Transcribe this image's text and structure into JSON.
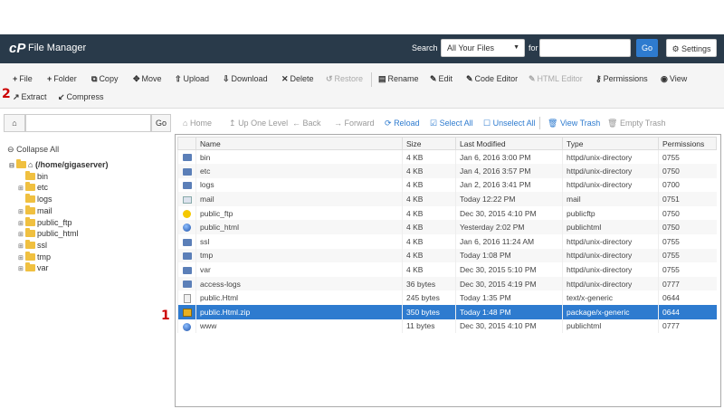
{
  "header": {
    "logo": "cP",
    "title": "File Manager",
    "search_label": "Search",
    "search_scope": "All Your Files",
    "for_label": "for",
    "search_value": "",
    "go_label": "Go",
    "settings_label": "Settings"
  },
  "toolbar": {
    "file": "File",
    "folder": "Folder",
    "copy": "Copy",
    "move": "Move",
    "upload": "Upload",
    "download": "Download",
    "delete": "Delete",
    "restore": "Restore",
    "rename": "Rename",
    "edit": "Edit",
    "code_editor": "Code Editor",
    "html_editor": "HTML Editor",
    "permissions": "Permissions",
    "view": "View",
    "extract": "Extract",
    "compress": "Compress"
  },
  "annotations": {
    "step1": "1",
    "step2": "2"
  },
  "left_pane": {
    "path_value": "",
    "go_label": "Go",
    "collapse_all": "Collapse All",
    "root": "(/home/gigaserver)",
    "tree": [
      "bin",
      "etc",
      "logs",
      "mail",
      "public_ftp",
      "public_html",
      "ssl",
      "tmp",
      "var"
    ]
  },
  "nav": {
    "home": "Home",
    "up": "Up One Level",
    "back": "Back",
    "forward": "Forward",
    "reload": "Reload",
    "select_all": "Select All",
    "unselect_all": "Unselect All",
    "view_trash": "View Trash",
    "empty_trash": "Empty Trash"
  },
  "table": {
    "headers": {
      "name": "Name",
      "size": "Size",
      "modified": "Last Modified",
      "type": "Type",
      "perms": "Permissions"
    },
    "rows": [
      {
        "icon": "dir",
        "name": "bin",
        "size": "4 KB",
        "modified": "Jan 6, 2016 3:00 PM",
        "type": "httpd/unix-directory",
        "perms": "0755"
      },
      {
        "icon": "dir",
        "name": "etc",
        "size": "4 KB",
        "modified": "Jan 4, 2016 3:57 PM",
        "type": "httpd/unix-directory",
        "perms": "0750"
      },
      {
        "icon": "dir",
        "name": "logs",
        "size": "4 KB",
        "modified": "Jan 2, 2016 3:41 PM",
        "type": "httpd/unix-directory",
        "perms": "0700"
      },
      {
        "icon": "mail",
        "name": "mail",
        "size": "4 KB",
        "modified": "Today 12:22 PM",
        "type": "mail",
        "perms": "0751"
      },
      {
        "icon": "ftp",
        "name": "public_ftp",
        "size": "4 KB",
        "modified": "Dec 30, 2015 4:10 PM",
        "type": "publicftp",
        "perms": "0750"
      },
      {
        "icon": "globe",
        "name": "public_html",
        "size": "4 KB",
        "modified": "Yesterday 2:02 PM",
        "type": "publichtml",
        "perms": "0750"
      },
      {
        "icon": "dir",
        "name": "ssl",
        "size": "4 KB",
        "modified": "Jan 6, 2016 11:24 AM",
        "type": "httpd/unix-directory",
        "perms": "0755"
      },
      {
        "icon": "dir",
        "name": "tmp",
        "size": "4 KB",
        "modified": "Today 1:08 PM",
        "type": "httpd/unix-directory",
        "perms": "0755"
      },
      {
        "icon": "dir",
        "name": "var",
        "size": "4 KB",
        "modified": "Dec 30, 2015 5:10 PM",
        "type": "httpd/unix-directory",
        "perms": "0755"
      },
      {
        "icon": "dir",
        "name": "access-logs",
        "size": "36 bytes",
        "modified": "Dec 30, 2015 4:19 PM",
        "type": "httpd/unix-directory",
        "perms": "0777"
      },
      {
        "icon": "text",
        "name": "public.Html",
        "size": "245 bytes",
        "modified": "Today 1:35 PM",
        "type": "text/x-generic",
        "perms": "0644"
      },
      {
        "icon": "zip",
        "name": "public.Html.zip",
        "size": "350 bytes",
        "modified": "Today 1:48 PM",
        "type": "package/x-generic",
        "perms": "0644",
        "selected": true
      },
      {
        "icon": "globe",
        "name": "www",
        "size": "11 bytes",
        "modified": "Dec 30, 2015 4:10 PM",
        "type": "publichtml",
        "perms": "0777"
      }
    ]
  }
}
